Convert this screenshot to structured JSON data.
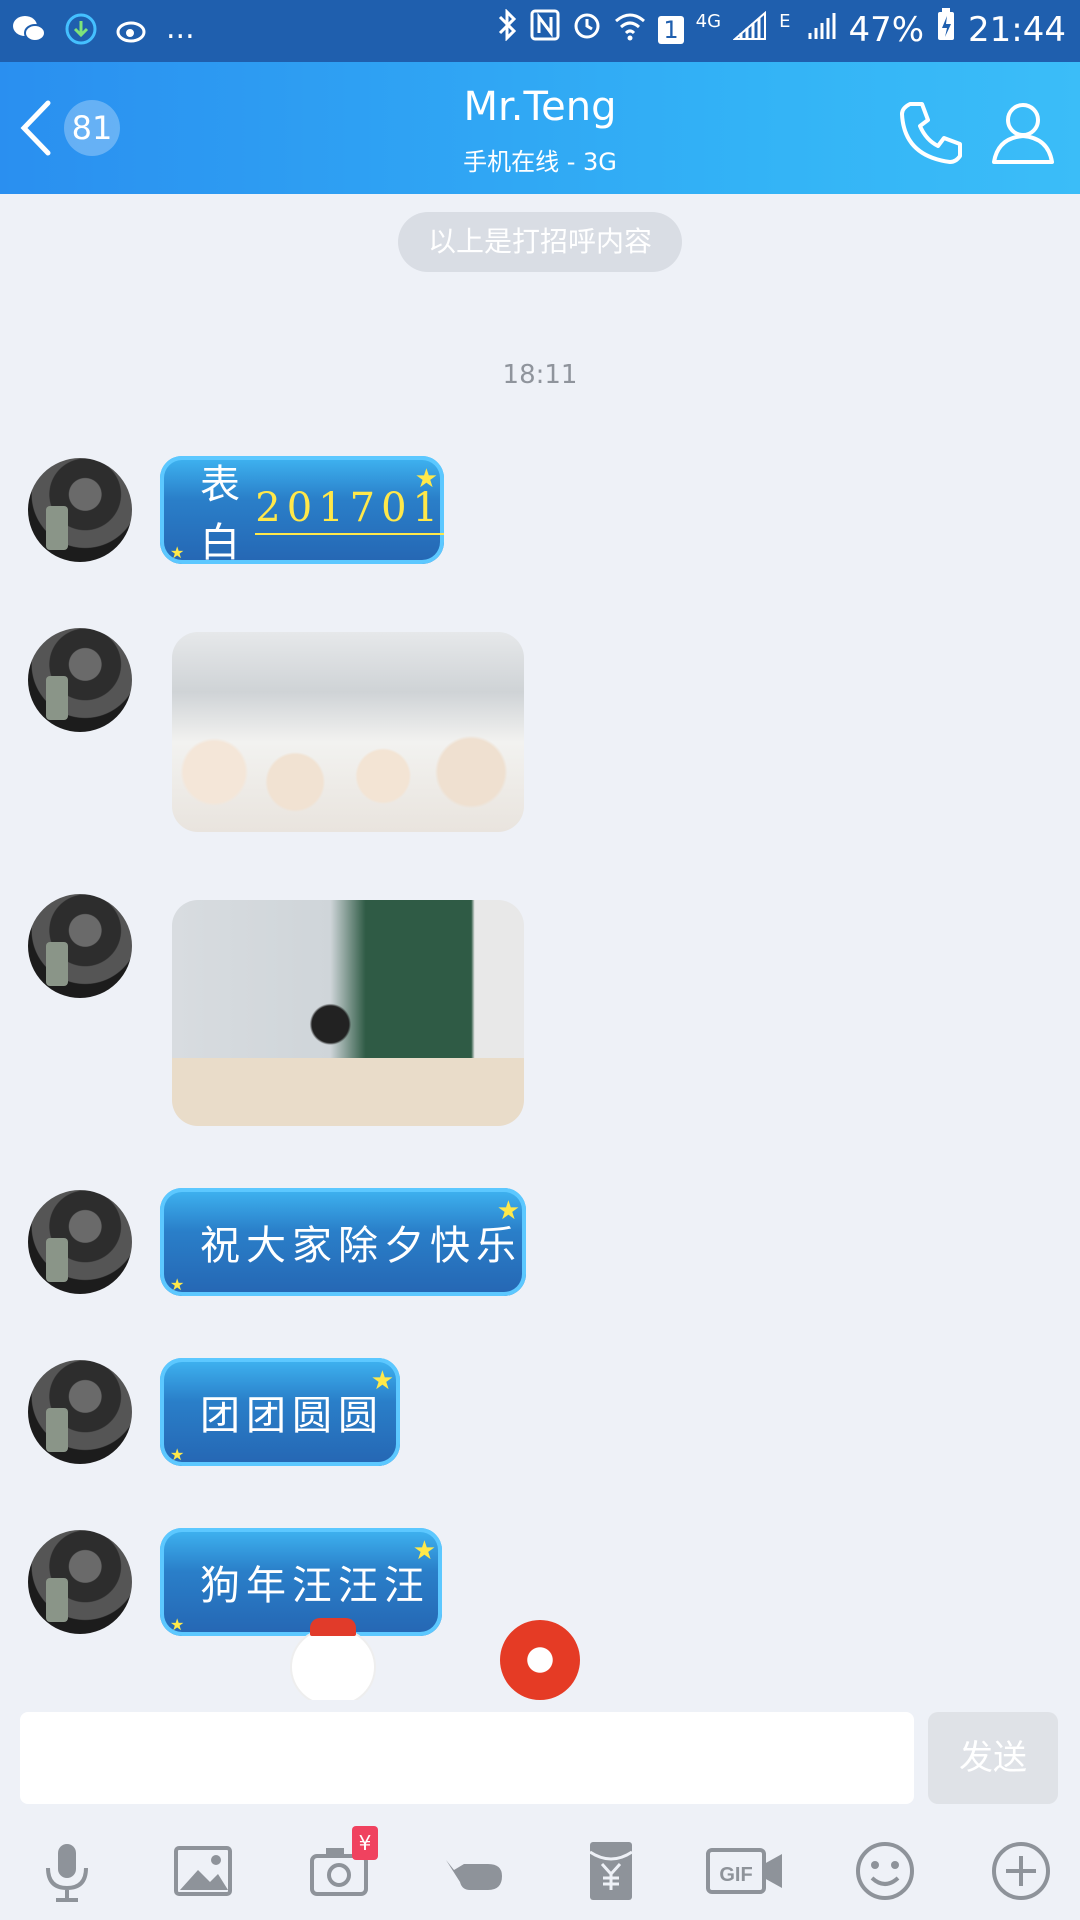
{
  "status_bar": {
    "network": "4G",
    "network2": "E",
    "sim": "1",
    "battery": "47%",
    "time": "21:44",
    "more": "..."
  },
  "header": {
    "back_badge": "81",
    "contact_name": "Mr.Teng",
    "contact_status": "手机在线 - 3G"
  },
  "chat": {
    "system_notice": "以上是打招呼内容",
    "timestamp": "18:11",
    "messages": [
      {
        "type": "text",
        "prefix": "表白",
        "highlight": "201701"
      },
      {
        "type": "image"
      },
      {
        "type": "image"
      },
      {
        "type": "text",
        "text": "祝大家除夕快乐"
      },
      {
        "type": "text",
        "text": "团团圆圆"
      },
      {
        "type": "text",
        "text": "狗年汪汪汪"
      }
    ]
  },
  "input": {
    "placeholder": "",
    "send_label": "发送"
  },
  "toolbar": {
    "items": [
      "microphone-icon",
      "image-icon",
      "camera-icon",
      "poke-icon",
      "red-envelope-icon",
      "gif-icon",
      "emoji-icon",
      "plus-icon"
    ],
    "camera_badge": "¥",
    "gif_label": "GIF"
  },
  "colors": {
    "header_start": "#2a8ff0",
    "header_end": "#3bbdf8",
    "background": "#eef1f7",
    "bubble": "#2a7fc9",
    "star": "#ffe94a"
  }
}
